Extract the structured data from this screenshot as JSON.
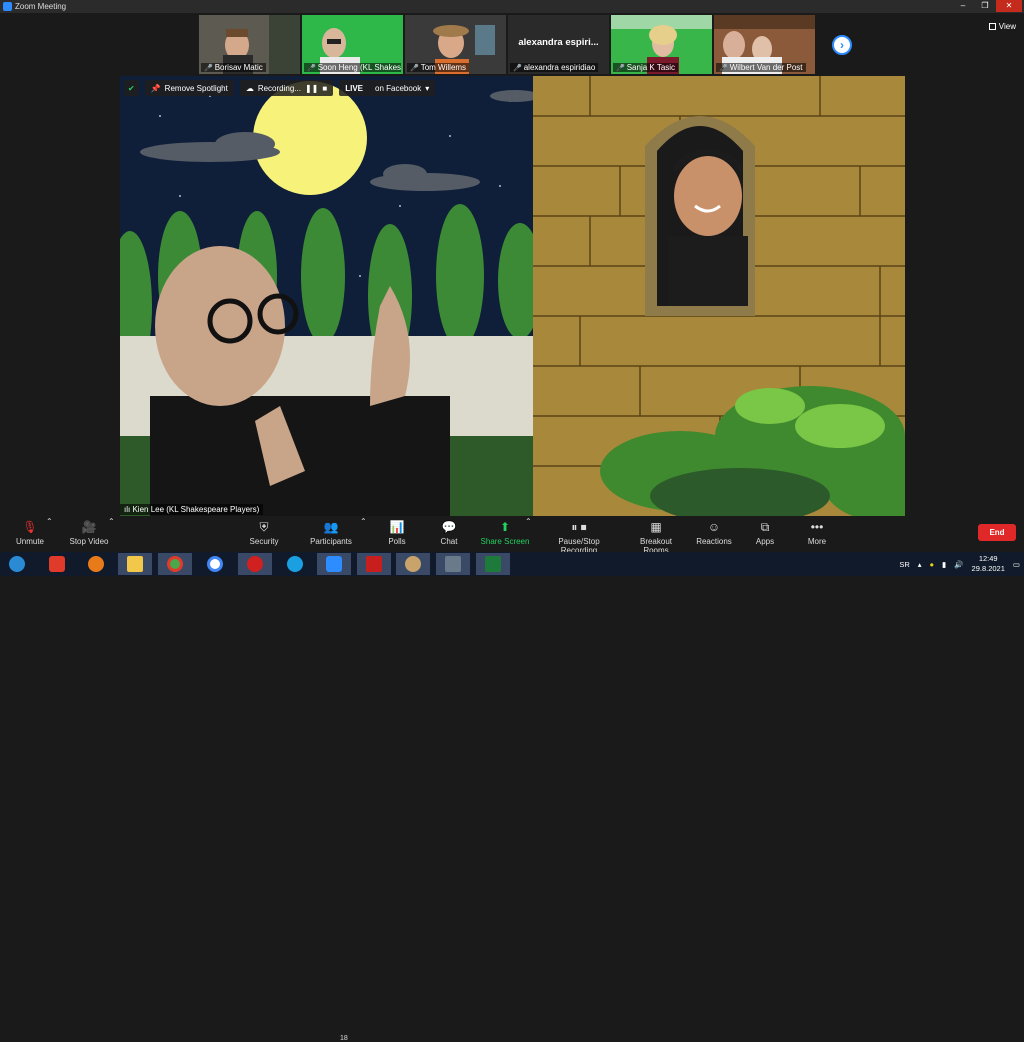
{
  "window": {
    "title": "Zoom Meeting"
  },
  "controls_window": {
    "minimize": "–",
    "restore": "❐",
    "close": "✕"
  },
  "view_label": "View",
  "participants_strip": [
    {
      "name": "Borisav Matic",
      "muted": true
    },
    {
      "name": "Soon Heng (KL Shakesp...",
      "muted": true
    },
    {
      "name": "Tom Willems",
      "muted": true
    },
    {
      "name": "alexandra espiridiao",
      "muted": true,
      "big_name": "alexandra   espiri..."
    },
    {
      "name": "Sanja K Tasic",
      "muted": true
    },
    {
      "name": "Wilbert Van der Post",
      "muted": true
    }
  ],
  "top_toolbar": {
    "remove_spotlight": "Remove Spotlight",
    "recording": "Recording...",
    "live": "LIVE",
    "live_on": "on Facebook"
  },
  "speaker_name": "Kien Lee (KL Shakespeare Players)",
  "bottom_controls": {
    "unmute": "Unmute",
    "stop_video": "Stop Video",
    "security": "Security",
    "participants": "Participants",
    "participants_count": "18",
    "polls": "Polls",
    "chat": "Chat",
    "share_screen": "Share Screen",
    "pause_stop_recording": "Pause/Stop Recording",
    "breakout_rooms": "Breakout Rooms",
    "reactions": "Reactions",
    "apps": "Apps",
    "more": "More",
    "end": "End"
  },
  "taskbar": {
    "language": "SR",
    "time": "12:49",
    "date": "29.8.2021"
  },
  "colors": {
    "accent": "#2d8cff",
    "live": "#e02828",
    "share_green": "#23d160"
  }
}
